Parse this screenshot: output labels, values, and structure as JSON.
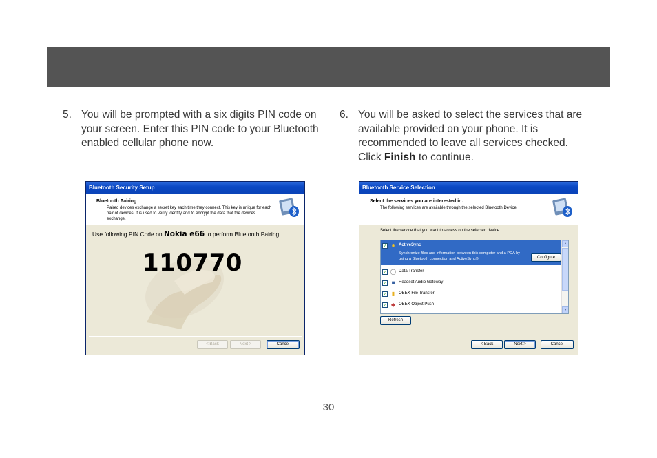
{
  "step5": {
    "number": "5.",
    "text": "You will be prompted with a six digits PIN code on your screen.  Enter this PIN code to your Bluetooth enabled cellular phone now."
  },
  "step6": {
    "number": "6.",
    "text_before": "You will be asked to select the services that are available provided on your phone.  It is recommended to leave all services checked. Click ",
    "bold": "Finish",
    "text_after": " to continue."
  },
  "dialog1": {
    "title": "Bluetooth Security Setup",
    "section_title": "Bluetooth Pairing",
    "section_desc": "Paired devices exchange a secret key each time they connect. This key is unique for each pair of devices; it is used to verify identity and to encrypt the data that the devices exchange.",
    "prompt_before": "Use following PIN Code on ",
    "device_name": "Nokia e66",
    "prompt_after": " to perform Bluetooth Pairing.",
    "pin": "110770",
    "back_label": "< Back",
    "next_label": "Next >",
    "cancel_label": "Cancel"
  },
  "dialog2": {
    "title": "Bluetooth Service Selection",
    "section_title": "Select the services you are interested in.",
    "section_desc": "The following services are available through the selected Bluetooth Device.",
    "instruction": "Select the service that you want to access on the selected device.",
    "services": [
      {
        "name": "ActiveSync",
        "desc": "Synchronize files and information between this computer and a PDA by using a Bluetooth connection and ActiveSync®",
        "checked": true,
        "icon": "activesync-icon"
      },
      {
        "name": "Data Transfer",
        "checked": true,
        "icon": "data-transfer-icon"
      },
      {
        "name": "Headset Audio Gateway",
        "checked": true,
        "icon": "headset-icon"
      },
      {
        "name": "OBEX File Transfer",
        "checked": true,
        "icon": "folder-icon"
      },
      {
        "name": "OBEX Object Push",
        "checked": true,
        "icon": "object-push-icon"
      }
    ],
    "configure_label": "Configure",
    "refresh_label": "Refresh",
    "back_label": "< Back",
    "next_label": "Next >",
    "cancel_label": "Cancel"
  },
  "page_number": "30",
  "colors": {
    "header_bar": "#545454",
    "titlebar": "#0b48c4",
    "selection": "#316ac5"
  }
}
